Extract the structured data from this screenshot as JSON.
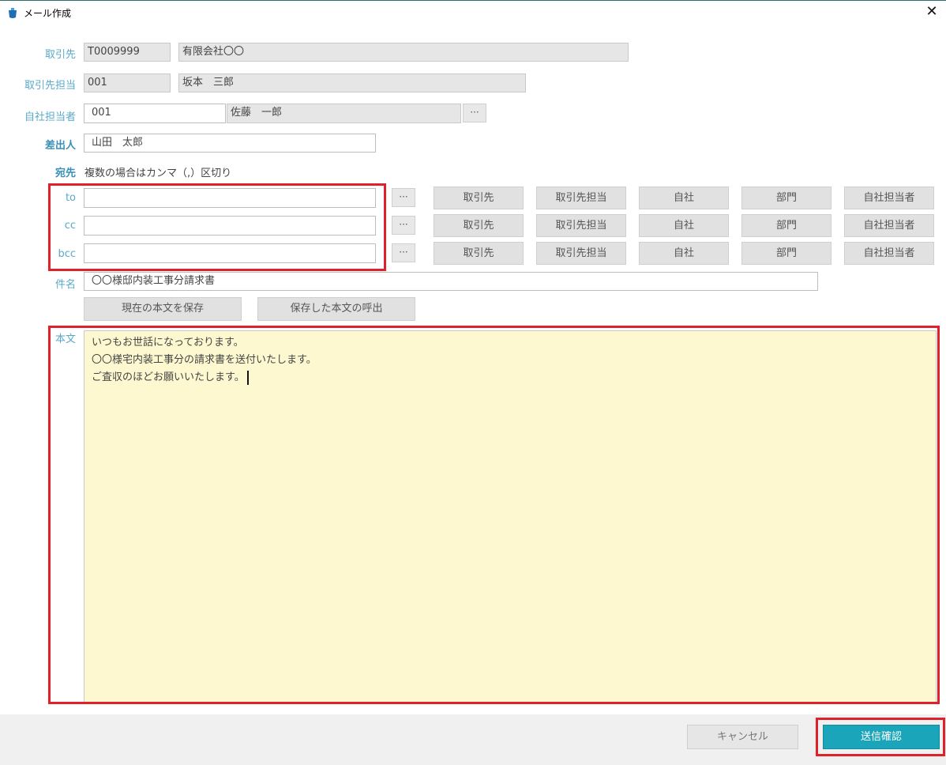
{
  "window": {
    "title": "メール作成",
    "close_glyph": "✕"
  },
  "form": {
    "client": {
      "label": "取引先",
      "code": "T0009999",
      "name": "有限会社〇〇"
    },
    "client_contact": {
      "label": "取引先担当",
      "code": "001",
      "name": "坂本　三郎"
    },
    "own_contact": {
      "label": "自社担当者",
      "code": "001",
      "name": "佐藤　一郎",
      "more": "···"
    },
    "sender": {
      "label": "差出人",
      "value": "山田　太郎"
    },
    "recipients": {
      "label": "宛先",
      "hint": "複数の場合はカンマ（,）区切り",
      "rows": [
        {
          "label": "to",
          "value": ""
        },
        {
          "label": "cc",
          "value": ""
        },
        {
          "label": "bcc",
          "value": ""
        }
      ],
      "more": "···",
      "buttons": [
        "取引先",
        "取引先担当",
        "自社",
        "部門",
        "自社担当者"
      ]
    },
    "subject": {
      "label": "件名",
      "value": "〇〇様邸内装工事分請求書"
    },
    "save_body_label": "現在の本文を保存",
    "load_body_label": "保存した本文の呼出",
    "body": {
      "label": "本文",
      "lines": [
        "いつもお世話になっております。",
        "〇〇様宅内装工事分の請求書を送付いたします。",
        "ご査収のほどお願いいたします。"
      ]
    }
  },
  "footer": {
    "cancel_label": "キャンセル",
    "send_label": "送信確認"
  },
  "colors": {
    "accent": "#1aa5ba",
    "label": "#59a9c9",
    "highlight": "#e0202b",
    "body_bg": "#fdf8cf"
  },
  "icons": {
    "app": "app-icon",
    "close": "close-icon",
    "more": "ellipsis-icon"
  }
}
